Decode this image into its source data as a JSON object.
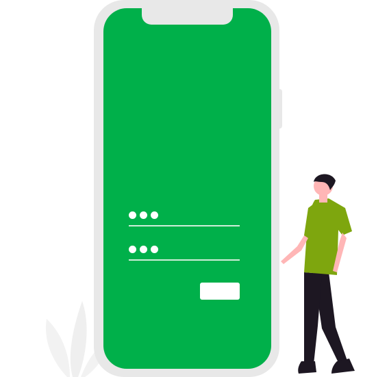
{
  "illustration": {
    "icons": {
      "plant": "plant-leaves-icon",
      "person": "standing-person-icon",
      "masked": "masked-input-dots-icon"
    },
    "colors": {
      "screen": "#00b04a",
      "frame": "#e8e8e8",
      "shirt": "#7ea60e",
      "pants": "#1d1722",
      "skin": "#ffb6b6",
      "hair": "#1d1722",
      "plant": "#f2f2f2",
      "field_line": "#e6f5ea",
      "button": "#ffffff"
    }
  },
  "login_form": {
    "username_field": {
      "masked_value": "•••"
    },
    "password_field": {
      "masked_value": "•••"
    },
    "submit_button": {
      "label": ""
    }
  }
}
